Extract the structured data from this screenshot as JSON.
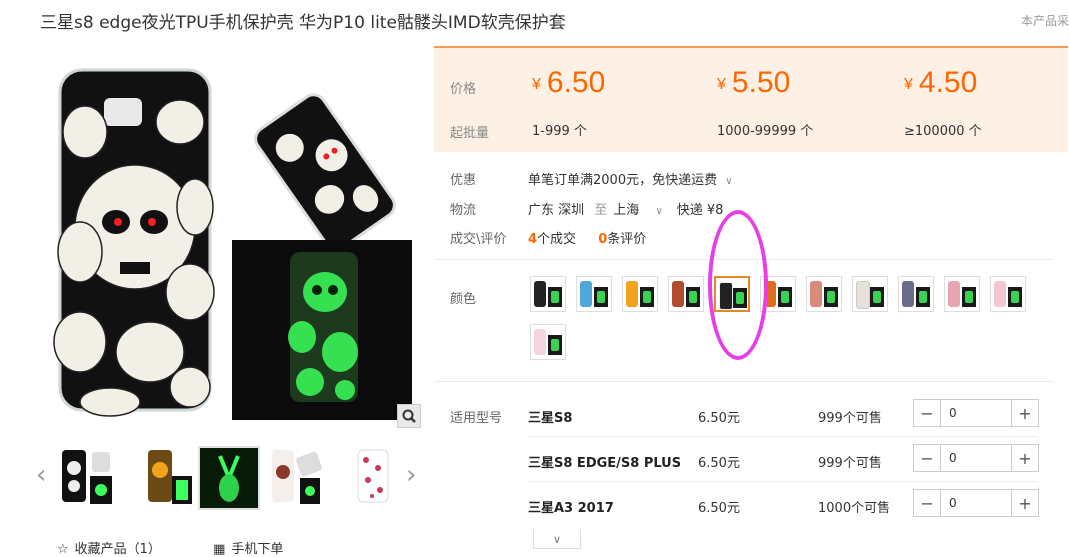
{
  "title": "三星s8 edge夜光TPU手机保护壳 华为P10 lite骷髅头IMD软壳保护套",
  "notice": "本产品采",
  "price_panel": {
    "price_label": "价格",
    "moq_label": "起批量",
    "currency": "¥",
    "tiers": [
      {
        "price": "6.50",
        "qty": "1-999 个"
      },
      {
        "price": "5.50",
        "qty": "1000-99999 个"
      },
      {
        "price": "4.50",
        "qty": "≥100000 个"
      }
    ]
  },
  "promo": {
    "label": "优惠",
    "text": "单笔订单满2000元，免快递运费"
  },
  "logistics": {
    "label": "物流",
    "from": "广东 深圳",
    "to_word": "至",
    "to": "上海",
    "method": "快递 ¥8"
  },
  "deals": {
    "label": "成交\\评价",
    "count": "4",
    "count_suffix": "个成交",
    "reviews": "0",
    "reviews_suffix": "条评价"
  },
  "color": {
    "label": "颜色",
    "selected_index": 4
  },
  "models": {
    "label": "适用型号",
    "rows": [
      {
        "name": "三星S8",
        "price": "6.50元",
        "stock": "999个可售",
        "qty": "0"
      },
      {
        "name": "三星S8 EDGE/S8 PLUS",
        "price": "6.50元",
        "stock": "999个可售",
        "qty": "0"
      },
      {
        "name": "三星A3 2017",
        "price": "6.50元",
        "stock": "1000个可售",
        "qty": "0"
      }
    ]
  },
  "actions": {
    "favorite": "收藏产品（1）",
    "mobile_order": "手机下单"
  },
  "colors": {
    "accent": "#ff6600",
    "selected_border": "#e48a25",
    "annotation": "#e83ee8"
  }
}
